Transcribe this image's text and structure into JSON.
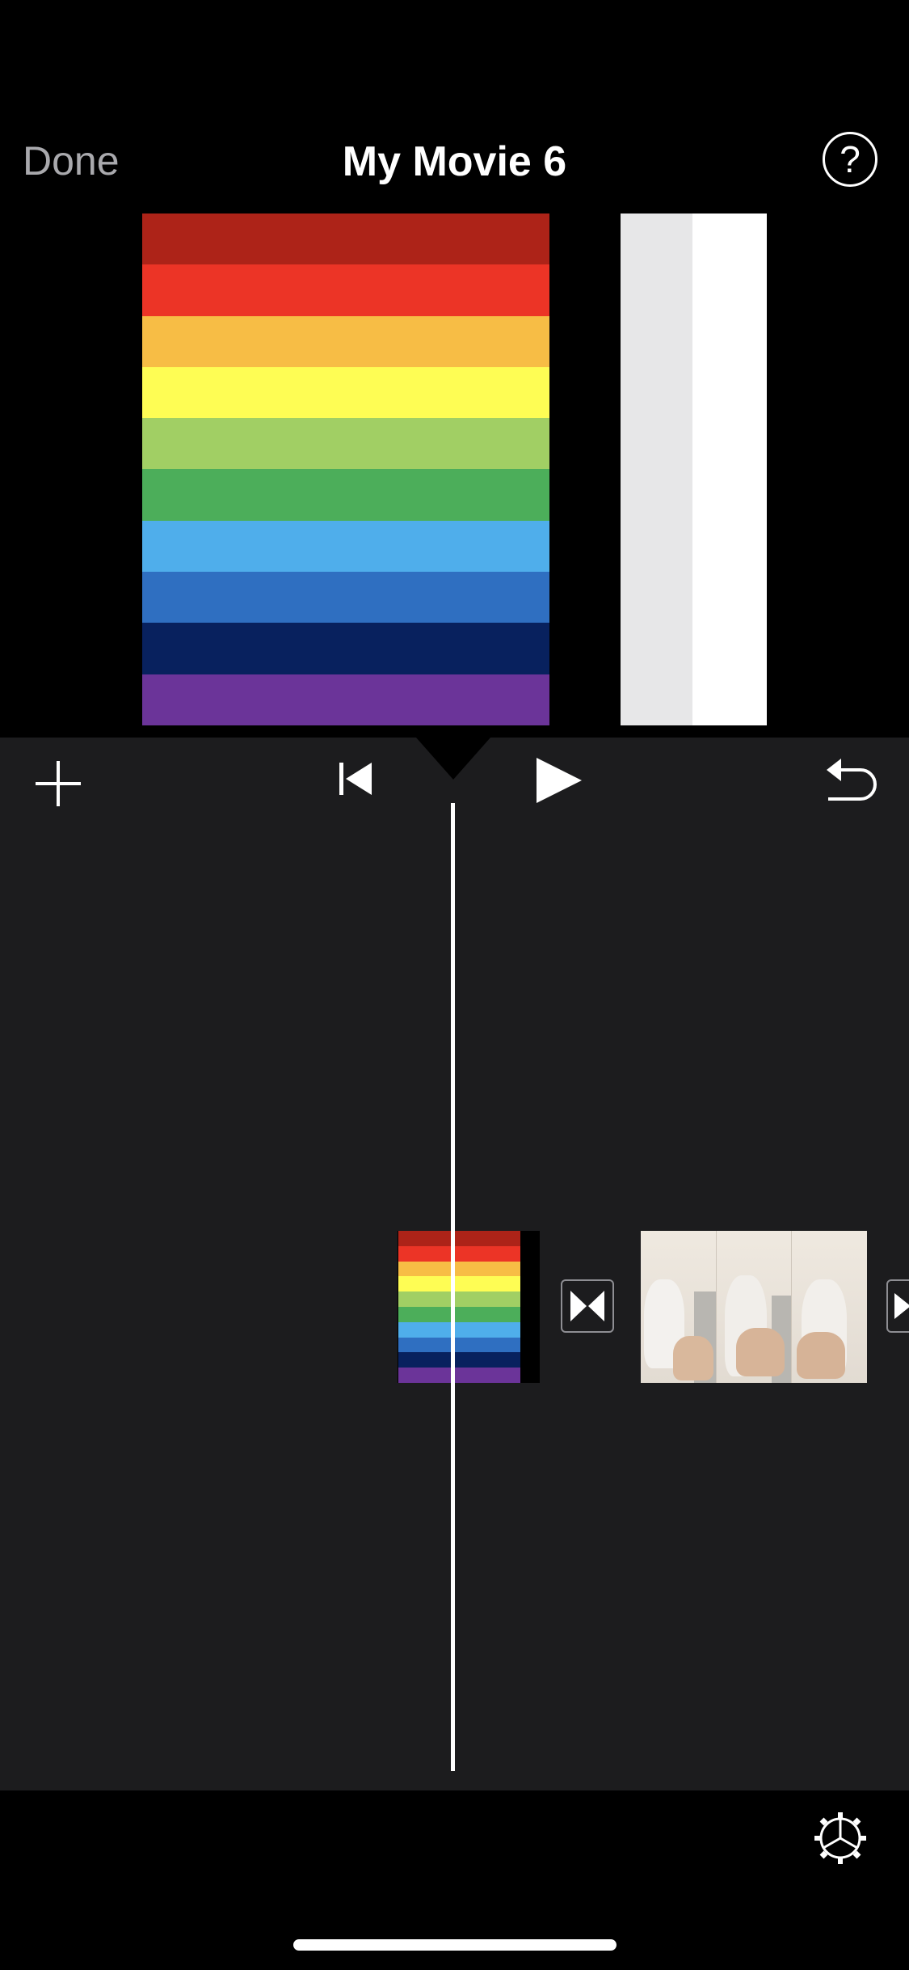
{
  "header": {
    "done_label": "Done",
    "title": "My Movie 6",
    "help_label": "?"
  },
  "preview": {
    "rainbow_colors": [
      "#ad2318",
      "#ec3426",
      "#f7bd45",
      "#fefd54",
      "#a1cf64",
      "#4cae5a",
      "#4faeeb",
      "#2f6fc1",
      "#08215e",
      "#6b3499"
    ],
    "white_panel_colors": [
      "#e7e7e8",
      "#ffffff"
    ]
  },
  "toolbar": {
    "add_icon": "plus-icon",
    "skip_back_icon": "skip-to-start-icon",
    "play_icon": "play-icon",
    "undo_icon": "undo-icon"
  },
  "timeline": {
    "background_color": "#1c1c1e",
    "clips": [
      {
        "type": "rainbow-title-clip"
      },
      {
        "type": "video-clip"
      }
    ],
    "transition_icon": "transition-icon"
  },
  "footer": {
    "settings_icon": "gear-icon"
  }
}
